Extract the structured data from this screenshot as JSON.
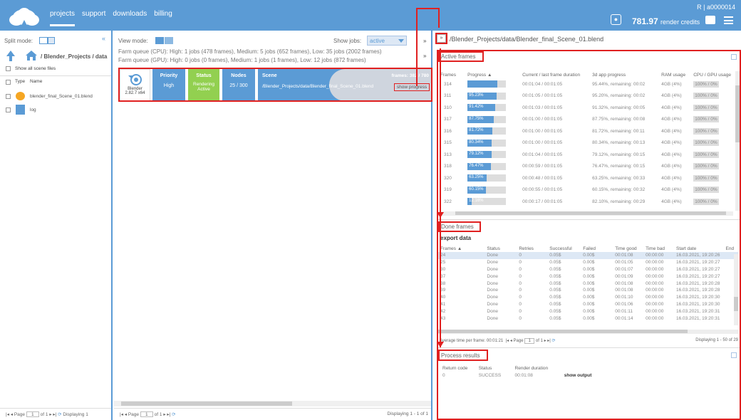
{
  "topbar": {
    "nav": [
      "projects",
      "support",
      "downloads",
      "billing"
    ],
    "account_id": "R | a0000014",
    "credits_value": "781.97",
    "credits_label": "render credits"
  },
  "left_pane": {
    "split_mode_label": "Split mode:",
    "collapse_glyph": "«",
    "breadcrumb": "/ Blender_Projects / data",
    "show_all_label": "Show all scene files",
    "col_type": "Type",
    "col_name": "Name",
    "files": [
      {
        "name": "blender_final_Scene_01.blend",
        "icon": "blender-icon"
      },
      {
        "name": "log",
        "icon": "folder-icon"
      }
    ],
    "pager": {
      "page_label": "Page",
      "page_value": "1",
      "of": "of 1",
      "displaying": "Displaying 1"
    }
  },
  "middle_pane": {
    "view_mode_label": "View mode:",
    "show_jobs_label": "Show jobs:",
    "show_jobs_value": "active",
    "expand_glyph": "»",
    "queue_cpu": "Farm queue (CPU): High: 1 jobs (478 frames), Medium: 5 jobs (652 frames), Low: 35 jobs (2002 frames)",
    "queue_gpu": "Farm queue (GPU): High: 0 jobs (0 frames), Medium: 1 jobs (1 frames), Low: 12 jobs (872 frames)",
    "job": {
      "app_name": "Blender",
      "app_version": "2.82.7 x64",
      "priority_label": "Priority",
      "priority_value": "High",
      "status_label": "Status",
      "status_value": "Rendering Active",
      "nodes_label": "Nodes",
      "nodes_value": "25 / 300",
      "scene_label": "Scene",
      "scene_value": "/Blender_Projects/data/Blender_final_Scene_01.blend",
      "frames_label": "frames: 382 / 780",
      "show_progress": "show progress"
    },
    "pager": {
      "page_label": "Page",
      "page_value": "1",
      "of": "of 1",
      "displaying": "Displaying 1 - 1 of 1"
    }
  },
  "right_pane": {
    "collapse_glyph": "»",
    "path": "/Blender_Projects/data/Blender_final_Scene_01.blend",
    "active_frames": {
      "title": "Active frames",
      "columns": [
        "Frames",
        "Progress ▲",
        "Current / last frame duration",
        "3d app progress",
        "RAM usage",
        "CPU / GPU usage"
      ],
      "rows": [
        {
          "frame": "314",
          "progress": "",
          "pct": 0.78,
          "duration": "00:01:04 / 00:01:05",
          "app": "95.44%, remaining: 00:02",
          "ram": "4GB (4%)",
          "cpu": "100% / 0%"
        },
        {
          "frame": "311",
          "progress": "95.23%",
          "pct": 0.75,
          "duration": "00:01:05 / 00:01:05",
          "app": "95.20%, remaining: 00:02",
          "ram": "4GB (4%)",
          "cpu": "100% / 0%"
        },
        {
          "frame": "310",
          "progress": "91.42%",
          "pct": 0.72,
          "duration": "00:01:03 / 00:01:05",
          "app": "91.32%, remaining: 00:05",
          "ram": "4GB (4%)",
          "cpu": "100% / 0%"
        },
        {
          "frame": "317",
          "progress": "87.75%",
          "pct": 0.69,
          "duration": "00:01:00 / 00:01:05",
          "app": "87.75%, remaining: 00:08",
          "ram": "4GB (4%)",
          "cpu": "100% / 0%"
        },
        {
          "frame": "316",
          "progress": "81.72%",
          "pct": 0.65,
          "duration": "00:01:00 / 00:01:05",
          "app": "81.72%, remaining: 00:11",
          "ram": "4GB (4%)",
          "cpu": "100% / 0%"
        },
        {
          "frame": "315",
          "progress": "80.34%",
          "pct": 0.63,
          "duration": "00:01:00 / 00:01:05",
          "app": "80.34%, remaining: 00:13",
          "ram": "4GB (4%)",
          "cpu": "100% / 0%"
        },
        {
          "frame": "313",
          "progress": "79.12%",
          "pct": 0.62,
          "duration": "00:01:04 / 00:01:05",
          "app": "79.12%, remaining: 00:15",
          "ram": "4GB (4%)",
          "cpu": "100% / 0%"
        },
        {
          "frame": "318",
          "progress": "76.47%",
          "pct": 0.6,
          "duration": "00:00:59 / 00:01:05",
          "app": "76.47%, remaining: 00:15",
          "ram": "4GB (4%)",
          "cpu": "100% / 0%"
        },
        {
          "frame": "320",
          "progress": "63.25%",
          "pct": 0.5,
          "duration": "00:00:48 / 00:01:05",
          "app": "63.25%, remaining: 00:33",
          "ram": "4GB (4%)",
          "cpu": "100% / 0%"
        },
        {
          "frame": "319",
          "progress": "60.15%",
          "pct": 0.47,
          "duration": "00:00:55 / 00:01:05",
          "app": "60.15%, remaining: 00:32",
          "ram": "4GB (4%)",
          "cpu": "100% / 0%"
        },
        {
          "frame": "322",
          "progress": "12.16%",
          "pct": 0.1,
          "duration": "00:00:17 / 00:01:05",
          "app": "82.10%, remaining: 00:29",
          "ram": "4GB (4%)",
          "cpu": "100% / 0%"
        }
      ]
    },
    "done_frames": {
      "title": "Done frames",
      "export_label": "export data",
      "columns": [
        "Frames ▲",
        "Status",
        "Retries",
        "Successful",
        "Failed",
        "Time good",
        "Time bad",
        "Start date",
        "End"
      ],
      "rows": [
        {
          "frame": "24",
          "status": "Done",
          "retries": "0",
          "success": "0.05$",
          "failed": "0.00$",
          "good": "00:01:08",
          "bad": "00:00:00",
          "start": "16.03.2021, 19:20:26"
        },
        {
          "frame": "25",
          "status": "Done",
          "retries": "0",
          "success": "0.05$",
          "failed": "0.00$",
          "good": "00:01:05",
          "bad": "00:00:00",
          "start": "16.03.2021, 19:20:27"
        },
        {
          "frame": "30",
          "status": "Done",
          "retries": "0",
          "success": "0.05$",
          "failed": "0.00$",
          "good": "00:01:07",
          "bad": "00:00:00",
          "start": "16.03.2021, 19:20:27"
        },
        {
          "frame": "37",
          "status": "Done",
          "retries": "0",
          "success": "0.05$",
          "failed": "0.00$",
          "good": "00:01:09",
          "bad": "00:00:00",
          "start": "16.03.2021, 19:20:27"
        },
        {
          "frame": "38",
          "status": "Done",
          "retries": "0",
          "success": "0.05$",
          "failed": "0.00$",
          "good": "00:01:08",
          "bad": "00:00:00",
          "start": "16.03.2021, 19:20:28"
        },
        {
          "frame": "39",
          "status": "Done",
          "retries": "0",
          "success": "0.05$",
          "failed": "0.00$",
          "good": "00:01:08",
          "bad": "00:00:00",
          "start": "16.03.2021, 19:20:28"
        },
        {
          "frame": "40",
          "status": "Done",
          "retries": "0",
          "success": "0.05$",
          "failed": "0.00$",
          "good": "00:01:10",
          "bad": "00:00:00",
          "start": "16.03.2021, 19:20:30"
        },
        {
          "frame": "41",
          "status": "Done",
          "retries": "0",
          "success": "0.05$",
          "failed": "0.00$",
          "good": "00:01:06",
          "bad": "00:00:00",
          "start": "16.03.2021, 19:20:30"
        },
        {
          "frame": "42",
          "status": "Done",
          "retries": "0",
          "success": "0.05$",
          "failed": "0.00$",
          "good": "00:01:11",
          "bad": "00:00:00",
          "start": "16.03.2021, 19:20:31"
        },
        {
          "frame": "43",
          "status": "Done",
          "retries": "0",
          "success": "0.05$",
          "failed": "0.00$",
          "good": "00:01:14",
          "bad": "00:00:00",
          "start": "16.03.2021, 19:20:31"
        }
      ],
      "avg_label": "Average time per frame: 00:01:21",
      "pager": {
        "page_label": "Page",
        "page_value": "1",
        "of": "of 1",
        "displaying": "Displaying 1 - 50 of 29"
      }
    },
    "process_results": {
      "title": "Process results",
      "columns": [
        "Return code",
        "Status",
        "Render duration"
      ],
      "row": {
        "code": "0",
        "status": "SUCCESS",
        "duration": "00:01:08",
        "action": "show output"
      }
    }
  },
  "colors": {
    "accent": "#5b9bd5",
    "status_green": "#92d050",
    "annotation": "#e02020"
  }
}
